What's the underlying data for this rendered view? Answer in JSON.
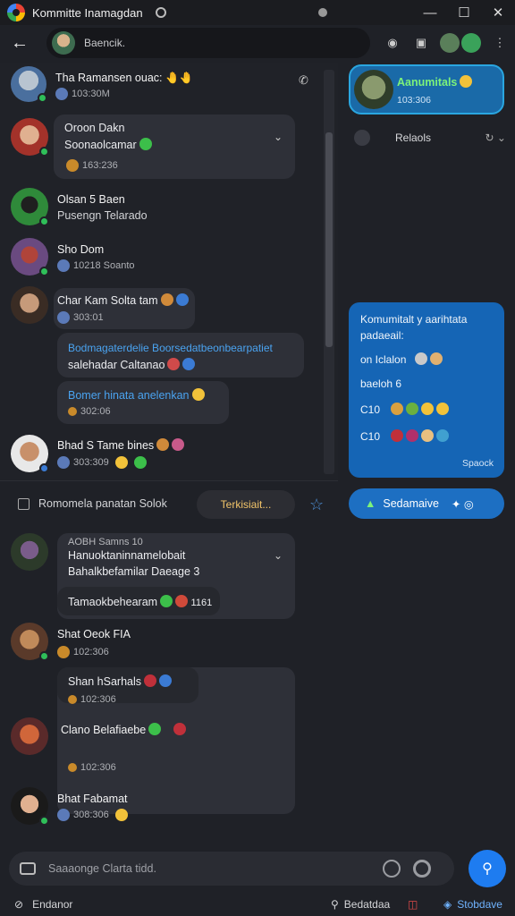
{
  "window": {
    "title": "Kommitte Inamagdan"
  },
  "win_controls": [
    "—",
    "☐",
    "✕"
  ],
  "topbar": {
    "search_text": "Baencik."
  },
  "threads": [
    {
      "name": "Tha Ramansen ouac: 🤚🤚",
      "meta": "103:30M",
      "color": "#4a6f9e"
    },
    {
      "name": "Oroon Dakn",
      "sub": "Soonaolcamar",
      "meta": "163:236",
      "color": "#a3322a",
      "bubble": true
    },
    {
      "name": "Olsan 5 Baen",
      "sub": "Pusengn Telarado",
      "color": "#2f8a3a"
    },
    {
      "name": "Sho Dom",
      "meta": "10218 Soanto",
      "color": "#6a4a80"
    },
    {
      "name": "Char Kam Solta tam",
      "meta": "303:01",
      "color": "#3a2c24"
    },
    {
      "line1": "Bodmagaterdelie Boorsedatbeonbearpatiet",
      "line2": "salehadar Caltanao",
      "line3": "Bomer hinata anelenkan",
      "meta": "302:06"
    },
    {
      "name": "Bhad S Tame bines",
      "meta": "303:309",
      "color": "#e8e8e8"
    }
  ],
  "right": {
    "card_title": "Aanumitals",
    "card_time": "103:306",
    "relations": "Relaols",
    "blue_lines": [
      "Komumitalt y aarihtata",
      "padaeail:",
      "on Iclalon",
      "baeloh  6",
      "C10",
      "C10"
    ],
    "blue_time": "Spaock",
    "green_pill": "Sedamaive"
  },
  "strip": {
    "check_label": "Romomela panatan Solok",
    "pill": "Terkisiait...",
    "star": "☆"
  },
  "lower": [
    {
      "meta_top": "AOBH Samns 10",
      "l1": "Hanuoktaninnamelobait",
      "l2": "Bahalkbefamilar Daeage 3",
      "l3": "Tamaokbehearam",
      "l3b": "1161"
    },
    {
      "name": "Shat Oeok FIA",
      "meta": "102:306"
    },
    {
      "name": "Shan hSarhals",
      "meta": "102:306"
    },
    {
      "name": "Clano Belafiaebe",
      "meta": "102:306"
    },
    {
      "name": "Bhat Fabamat",
      "meta": "308:306"
    }
  ],
  "composer": {
    "placeholder": "Saaaonge Clarta tidd."
  },
  "footer": {
    "left": "Endanor",
    "mid": "Bedatdaa",
    "right": "Stobdave"
  }
}
